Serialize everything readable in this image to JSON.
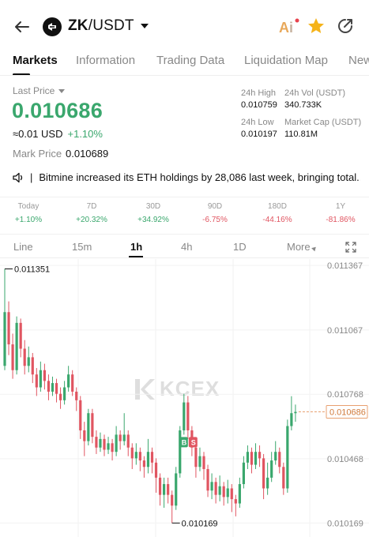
{
  "header": {
    "base": "ZK",
    "quote": "/USDT",
    "icons": [
      "back-arrow-icon",
      "zk-logo-icon",
      "ai-icon",
      "star-icon",
      "share-icon"
    ],
    "star_color": "#f5b319"
  },
  "tabs": [
    {
      "label": "Markets",
      "active": true
    },
    {
      "label": "Information",
      "active": false
    },
    {
      "label": "Trading Data",
      "active": false
    },
    {
      "label": "Liquidation Map",
      "active": false
    },
    {
      "label": "New",
      "active": false
    }
  ],
  "price": {
    "last_price_label": "Last Price",
    "last_price": "0.010686",
    "usd_value": "≈0.01 USD",
    "change": "+1.10%",
    "mark_label": "Mark Price",
    "mark_value": "0.010689",
    "up_color": "#3aa76d",
    "down_color": "#e05561"
  },
  "stats": {
    "high_label": "24h High",
    "high_value": "0.010759",
    "vol_label": "24h Vol (USDT)",
    "vol_value": "340.733K",
    "low_label": "24h Low",
    "low_value": "0.010197",
    "cap_label": "Market Cap (USDT)",
    "cap_value": "110.81M"
  },
  "news": {
    "text": "Bitmine increased its ETH holdings by 28,086 last week, bringing total..."
  },
  "performance": [
    {
      "label": "Today",
      "value": "+1.10%",
      "dir": "up"
    },
    {
      "label": "7D",
      "value": "+20.32%",
      "dir": "up"
    },
    {
      "label": "30D",
      "value": "+34.92%",
      "dir": "up"
    },
    {
      "label": "90D",
      "value": "-6.75%",
      "dir": "down"
    },
    {
      "label": "180D",
      "value": "-44.16%",
      "dir": "down"
    },
    {
      "label": "1Y",
      "value": "-81.86%",
      "dir": "down"
    }
  ],
  "intervals": [
    {
      "label": "Line",
      "active": false
    },
    {
      "label": "15m",
      "active": false
    },
    {
      "label": "1h",
      "active": true
    },
    {
      "label": "4h",
      "active": false
    },
    {
      "label": "1D",
      "active": false
    },
    {
      "label": "More",
      "active": false
    }
  ],
  "chart_data": {
    "type": "candlestick",
    "y_ticks": [
      "0.011367",
      "0.011067",
      "0.010768",
      "0.010468",
      "0.010169"
    ],
    "y_tick_values": [
      0.011367,
      0.011067,
      0.010768,
      0.010468,
      0.010169
    ],
    "ylim": [
      0.010104,
      0.011397
    ],
    "high_label": "0.011351",
    "low_label": "0.010169",
    "current_price_label": "0.010686",
    "current_price": 0.010686,
    "markers": [
      "B",
      "S"
    ],
    "watermark": "KCEX",
    "candles": [
      [
        0.0109,
        0.01115,
        0.011351,
        0.01088
      ],
      [
        0.01115,
        0.011,
        0.0112,
        0.01095
      ],
      [
        0.011,
        0.01088,
        0.01105,
        0.01084
      ],
      [
        0.01088,
        0.0111,
        0.01113,
        0.01086
      ],
      [
        0.0111,
        0.01098,
        0.01112,
        0.01094
      ],
      [
        0.01098,
        0.0109,
        0.01102,
        0.01086
      ],
      [
        0.0109,
        0.01094,
        0.01099,
        0.01087
      ],
      [
        0.01094,
        0.01086,
        0.01096,
        0.01082
      ],
      [
        0.01086,
        0.0108,
        0.01089,
        0.01076
      ],
      [
        0.0108,
        0.01088,
        0.01092,
        0.01078
      ],
      [
        0.01088,
        0.01083,
        0.01091,
        0.01079
      ],
      [
        0.01083,
        0.01078,
        0.01086,
        0.01074
      ],
      [
        0.01078,
        0.01082,
        0.01085,
        0.01076
      ],
      [
        0.01082,
        0.01077,
        0.01084,
        0.01073
      ],
      [
        0.01077,
        0.01074,
        0.0108,
        0.0107
      ],
      [
        0.01074,
        0.0108,
        0.01083,
        0.01072
      ],
      [
        0.0108,
        0.01086,
        0.0109,
        0.01078
      ],
      [
        0.01086,
        0.01078,
        0.01088,
        0.01076
      ],
      [
        0.01078,
        0.01074,
        0.0108,
        0.01069
      ],
      [
        0.01074,
        0.0106,
        0.01076,
        0.01056
      ],
      [
        0.0106,
        0.01055,
        0.01064,
        0.01048
      ],
      [
        0.01055,
        0.01068,
        0.0107,
        0.01053
      ],
      [
        0.01068,
        0.01057,
        0.0107,
        0.01054
      ],
      [
        0.01057,
        0.01052,
        0.0106,
        0.01049
      ],
      [
        0.01052,
        0.01056,
        0.01059,
        0.0105
      ],
      [
        0.01056,
        0.01051,
        0.01058,
        0.01048
      ],
      [
        0.01051,
        0.01054,
        0.01057,
        0.01049
      ],
      [
        0.01054,
        0.0105,
        0.01056,
        0.01046
      ],
      [
        0.0105,
        0.01058,
        0.01062,
        0.01048
      ],
      [
        0.01058,
        0.01055,
        0.0106,
        0.01051
      ],
      [
        0.01055,
        0.01058,
        0.01068,
        0.01053
      ],
      [
        0.01058,
        0.01052,
        0.0106,
        0.01048
      ],
      [
        0.01052,
        0.01047,
        0.01054,
        0.01042
      ],
      [
        0.01047,
        0.0105,
        0.01054,
        0.01044
      ],
      [
        0.0105,
        0.01046,
        0.01052,
        0.01041
      ],
      [
        0.01046,
        0.01043,
        0.01048,
        0.01038
      ],
      [
        0.01043,
        0.0105,
        0.01056,
        0.0104
      ],
      [
        0.0105,
        0.01045,
        0.01052,
        0.0104
      ],
      [
        0.01045,
        0.01038,
        0.01047,
        0.01031
      ],
      [
        0.01038,
        0.0103,
        0.0104,
        0.01025
      ],
      [
        0.0103,
        0.01035,
        0.01038,
        0.01024
      ],
      [
        0.01035,
        0.0103,
        0.01038,
        0.01026
      ],
      [
        0.0103,
        0.01025,
        0.01032,
        0.010169
      ],
      [
        0.01025,
        0.0104,
        0.01043,
        0.01023
      ],
      [
        0.0104,
        0.0106,
        0.01062,
        0.01038
      ],
      [
        0.0106,
        0.01073,
        0.01077,
        0.01058
      ],
      [
        0.01073,
        0.0106,
        0.01076,
        0.01056
      ],
      [
        0.0106,
        0.01052,
        0.01062,
        0.01048
      ],
      [
        0.01052,
        0.01043,
        0.01054,
        0.01038
      ],
      [
        0.01043,
        0.01048,
        0.01052,
        0.01041
      ],
      [
        0.01048,
        0.01042,
        0.0105,
        0.01037
      ],
      [
        0.01042,
        0.01032,
        0.01044,
        0.01029
      ],
      [
        0.01032,
        0.01036,
        0.0104,
        0.01028
      ],
      [
        0.01036,
        0.0103,
        0.01038,
        0.01026
      ],
      [
        0.0103,
        0.01034,
        0.01039,
        0.01027
      ],
      [
        0.01034,
        0.01029,
        0.01036,
        0.01025
      ],
      [
        0.01029,
        0.01033,
        0.01037,
        0.01026
      ],
      [
        0.01033,
        0.01028,
        0.01035,
        0.01022
      ],
      [
        0.01028,
        0.01026,
        0.0103,
        0.0102
      ],
      [
        0.01026,
        0.01035,
        0.01038,
        0.01024
      ],
      [
        0.01035,
        0.01045,
        0.01048,
        0.01033
      ],
      [
        0.01045,
        0.0105,
        0.01053,
        0.01042
      ],
      [
        0.0105,
        0.01044,
        0.01052,
        0.0104
      ],
      [
        0.01044,
        0.0105,
        0.01054,
        0.01042
      ],
      [
        0.0105,
        0.01047,
        0.01053,
        0.01043
      ],
      [
        0.01047,
        0.01033,
        0.01049,
        0.01028
      ],
      [
        0.01033,
        0.01038,
        0.01045,
        0.0103
      ],
      [
        0.01038,
        0.01046,
        0.0105,
        0.01036
      ],
      [
        0.01046,
        0.0105,
        0.01055,
        0.01044
      ],
      [
        0.0105,
        0.01043,
        0.01052,
        0.0104
      ],
      [
        0.01043,
        0.01033,
        0.01045,
        0.0103
      ],
      [
        0.01033,
        0.01062,
        0.01065,
        0.01031
      ],
      [
        0.01062,
        0.01068,
        0.010759,
        0.0106
      ],
      [
        0.01068,
        0.010686,
        0.01072,
        0.01064
      ]
    ]
  }
}
